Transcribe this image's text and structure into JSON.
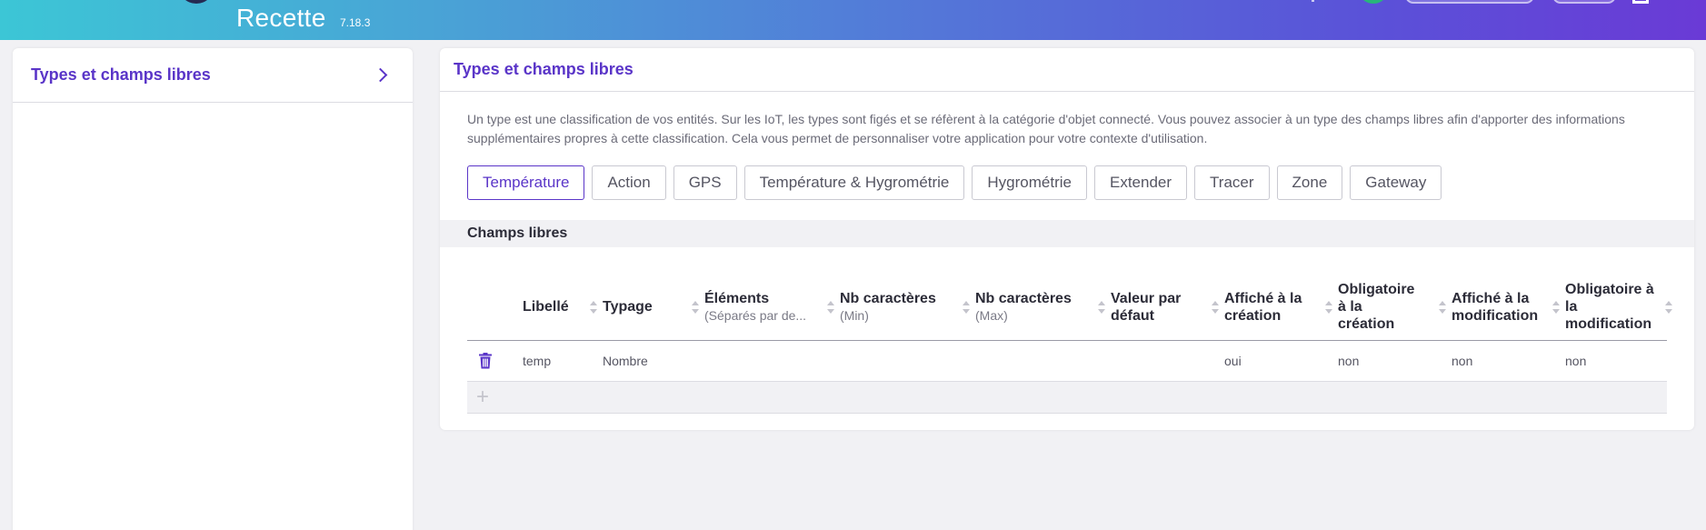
{
  "header": {
    "environment": "Recette",
    "version": "7.18.3",
    "colors": {
      "gradient_start": "#3cc6d6",
      "gradient_end": "#6a3ad6"
    }
  },
  "sidebar": {
    "items": [
      {
        "label": "Types et champs libres",
        "icon": "chevron-right-icon"
      }
    ]
  },
  "main": {
    "title": "Types et champs libres",
    "description": "Un type est une classification de vos entités. Sur les IoT, les types sont figés et se réfèrent à la catégorie d'objet connecté. Vous pouvez associer à un type des champs libres afin d'apporter des informations supplémentaires propres à cette classification. Cela vous permet de personnaliser votre application pour votre contexte d'utilisation.",
    "types": [
      {
        "label": "Température",
        "active": true
      },
      {
        "label": "Action",
        "active": false
      },
      {
        "label": "GPS",
        "active": false
      },
      {
        "label": "Température & Hygrométrie",
        "active": false
      },
      {
        "label": "Hygrométrie",
        "active": false
      },
      {
        "label": "Extender",
        "active": false
      },
      {
        "label": "Tracer",
        "active": false
      },
      {
        "label": "Zone",
        "active": false
      },
      {
        "label": "Gateway",
        "active": false
      }
    ],
    "section_title": "Champs libres",
    "table": {
      "columns": [
        {
          "label": "Libellé",
          "sub": ""
        },
        {
          "label": "Typage",
          "sub": ""
        },
        {
          "label": "Éléments",
          "sub": "(Séparés par de..."
        },
        {
          "label": "Nb caractères",
          "sub": "(Min)"
        },
        {
          "label": "Nb caractères",
          "sub": "(Max)"
        },
        {
          "label": "Valeur par défaut",
          "sub": ""
        },
        {
          "label": "Affiché à la création",
          "sub": ""
        },
        {
          "label": "Obligatoire à la création",
          "sub": ""
        },
        {
          "label": "Affiché à la modification",
          "sub": ""
        },
        {
          "label": "Obligatoire à la modification",
          "sub": ""
        }
      ],
      "rows": [
        {
          "libelle": "temp",
          "typage": "Nombre",
          "elements": "",
          "min": "",
          "max": "",
          "defaut": "",
          "affiche_creation": "oui",
          "oblig_creation": "non",
          "affiche_modif": "non",
          "oblig_modif": "non"
        }
      ],
      "add_icon": "plus-icon",
      "delete_icon": "trash-icon"
    },
    "colors": {
      "accent": "#5a35c8"
    }
  }
}
